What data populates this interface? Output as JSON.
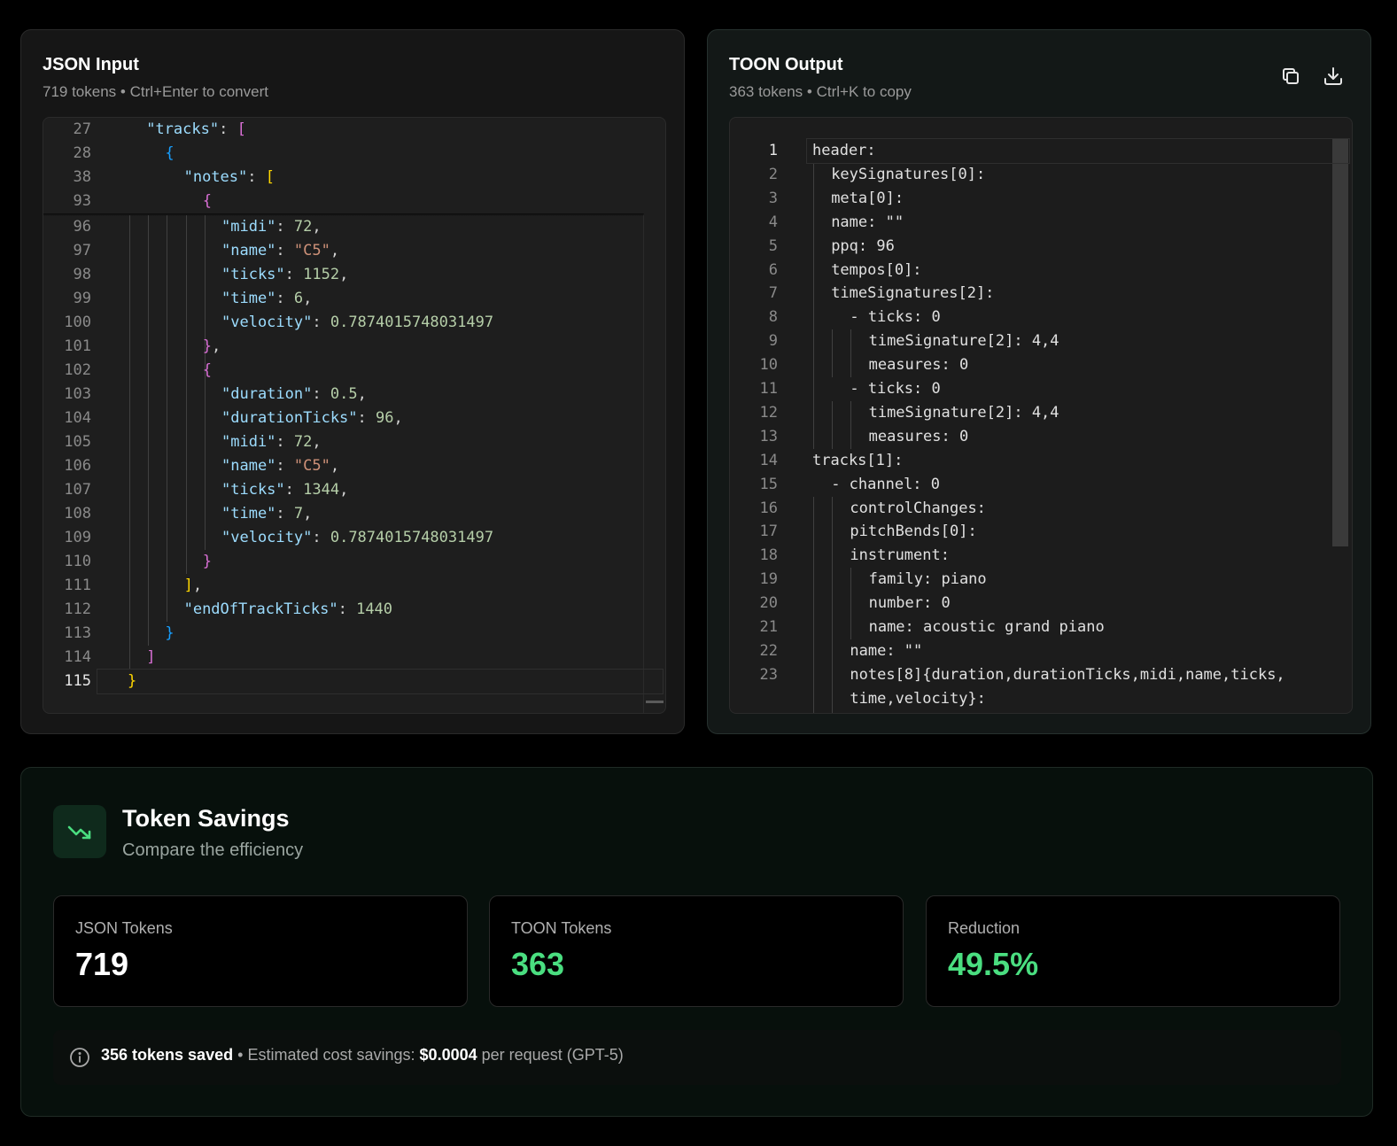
{
  "json_panel": {
    "title": "JSON Input",
    "token_count": "719 tokens",
    "separator": "•",
    "hint": "Ctrl+Enter to convert"
  },
  "toon_panel": {
    "title": "TOON Output",
    "token_count": "363 tokens",
    "separator": "•",
    "hint": "Ctrl+K to copy",
    "copy_icon": "copy-icon",
    "download_icon": "download-icon"
  },
  "json_editor": {
    "sticky": [
      {
        "ln": "27",
        "indent": 1,
        "tokens": [
          {
            "t": "\"tracks\"",
            "c": "k"
          },
          {
            "t": ": ",
            "c": "p"
          },
          {
            "t": "[",
            "c": "b2"
          }
        ]
      },
      {
        "ln": "28",
        "indent": 2,
        "tokens": [
          {
            "t": "{",
            "c": "b3"
          }
        ]
      },
      {
        "ln": "38",
        "indent": 3,
        "tokens": [
          {
            "t": "\"notes\"",
            "c": "k"
          },
          {
            "t": ": ",
            "c": "p"
          },
          {
            "t": "[",
            "c": "b1"
          }
        ]
      },
      {
        "ln": "93",
        "indent": 4,
        "tokens": [
          {
            "t": "{",
            "c": "b2"
          }
        ]
      }
    ],
    "lines": [
      {
        "ln": "96",
        "indent": 5,
        "tokens": [
          {
            "t": "\"midi\"",
            "c": "k"
          },
          {
            "t": ": ",
            "c": "p"
          },
          {
            "t": "72",
            "c": "n"
          },
          {
            "t": ",",
            "c": "p"
          }
        ]
      },
      {
        "ln": "97",
        "indent": 5,
        "tokens": [
          {
            "t": "\"name\"",
            "c": "k"
          },
          {
            "t": ": ",
            "c": "p"
          },
          {
            "t": "\"C5\"",
            "c": "s"
          },
          {
            "t": ",",
            "c": "p"
          }
        ]
      },
      {
        "ln": "98",
        "indent": 5,
        "tokens": [
          {
            "t": "\"ticks\"",
            "c": "k"
          },
          {
            "t": ": ",
            "c": "p"
          },
          {
            "t": "1152",
            "c": "n"
          },
          {
            "t": ",",
            "c": "p"
          }
        ]
      },
      {
        "ln": "99",
        "indent": 5,
        "tokens": [
          {
            "t": "\"time\"",
            "c": "k"
          },
          {
            "t": ": ",
            "c": "p"
          },
          {
            "t": "6",
            "c": "n"
          },
          {
            "t": ",",
            "c": "p"
          }
        ]
      },
      {
        "ln": "100",
        "indent": 5,
        "tokens": [
          {
            "t": "\"velocity\"",
            "c": "k"
          },
          {
            "t": ": ",
            "c": "p"
          },
          {
            "t": "0.7874015748031497",
            "c": "n"
          }
        ]
      },
      {
        "ln": "101",
        "indent": 4,
        "tokens": [
          {
            "t": "}",
            "c": "b2"
          },
          {
            "t": ",",
            "c": "p"
          }
        ]
      },
      {
        "ln": "102",
        "indent": 4,
        "tokens": [
          {
            "t": "{",
            "c": "b2"
          }
        ]
      },
      {
        "ln": "103",
        "indent": 5,
        "tokens": [
          {
            "t": "\"duration\"",
            "c": "k"
          },
          {
            "t": ": ",
            "c": "p"
          },
          {
            "t": "0.5",
            "c": "n"
          },
          {
            "t": ",",
            "c": "p"
          }
        ]
      },
      {
        "ln": "104",
        "indent": 5,
        "tokens": [
          {
            "t": "\"durationTicks\"",
            "c": "k"
          },
          {
            "t": ": ",
            "c": "p"
          },
          {
            "t": "96",
            "c": "n"
          },
          {
            "t": ",",
            "c": "p"
          }
        ]
      },
      {
        "ln": "105",
        "indent": 5,
        "tokens": [
          {
            "t": "\"midi\"",
            "c": "k"
          },
          {
            "t": ": ",
            "c": "p"
          },
          {
            "t": "72",
            "c": "n"
          },
          {
            "t": ",",
            "c": "p"
          }
        ]
      },
      {
        "ln": "106",
        "indent": 5,
        "tokens": [
          {
            "t": "\"name\"",
            "c": "k"
          },
          {
            "t": ": ",
            "c": "p"
          },
          {
            "t": "\"C5\"",
            "c": "s"
          },
          {
            "t": ",",
            "c": "p"
          }
        ]
      },
      {
        "ln": "107",
        "indent": 5,
        "tokens": [
          {
            "t": "\"ticks\"",
            "c": "k"
          },
          {
            "t": ": ",
            "c": "p"
          },
          {
            "t": "1344",
            "c": "n"
          },
          {
            "t": ",",
            "c": "p"
          }
        ]
      },
      {
        "ln": "108",
        "indent": 5,
        "tokens": [
          {
            "t": "\"time\"",
            "c": "k"
          },
          {
            "t": ": ",
            "c": "p"
          },
          {
            "t": "7",
            "c": "n"
          },
          {
            "t": ",",
            "c": "p"
          }
        ]
      },
      {
        "ln": "109",
        "indent": 5,
        "tokens": [
          {
            "t": "\"velocity\"",
            "c": "k"
          },
          {
            "t": ": ",
            "c": "p"
          },
          {
            "t": "0.7874015748031497",
            "c": "n"
          }
        ]
      },
      {
        "ln": "110",
        "indent": 4,
        "tokens": [
          {
            "t": "}",
            "c": "b2"
          }
        ]
      },
      {
        "ln": "111",
        "indent": 3,
        "tokens": [
          {
            "t": "]",
            "c": "b1"
          },
          {
            "t": ",",
            "c": "p"
          }
        ]
      },
      {
        "ln": "112",
        "indent": 3,
        "tokens": [
          {
            "t": "\"endOfTrackTicks\"",
            "c": "k"
          },
          {
            "t": ": ",
            "c": "p"
          },
          {
            "t": "1440",
            "c": "n"
          }
        ]
      },
      {
        "ln": "113",
        "indent": 2,
        "tokens": [
          {
            "t": "}",
            "c": "b3"
          }
        ]
      },
      {
        "ln": "114",
        "indent": 1,
        "tokens": [
          {
            "t": "]",
            "c": "b2"
          }
        ]
      },
      {
        "ln": "115",
        "indent": 0,
        "tokens": [
          {
            "t": "}",
            "c": "b1"
          }
        ],
        "current": true
      }
    ]
  },
  "toon_editor": {
    "lines": [
      {
        "ln": "1",
        "indent": 0,
        "text": "header:",
        "current": true
      },
      {
        "ln": "2",
        "indent": 1,
        "text": "keySignatures[0]:"
      },
      {
        "ln": "3",
        "indent": 1,
        "text": "meta[0]:"
      },
      {
        "ln": "4",
        "indent": 1,
        "text": "name: \"\""
      },
      {
        "ln": "5",
        "indent": 1,
        "text": "ppq: 96"
      },
      {
        "ln": "6",
        "indent": 1,
        "text": "tempos[0]:"
      },
      {
        "ln": "7",
        "indent": 1,
        "text": "timeSignatures[2]:"
      },
      {
        "ln": "8",
        "indent": 2,
        "text": "- ticks: 0"
      },
      {
        "ln": "9",
        "indent": 3,
        "text": "timeSignature[2]: 4,4"
      },
      {
        "ln": "10",
        "indent": 3,
        "text": "measures: 0"
      },
      {
        "ln": "11",
        "indent": 2,
        "text": "- ticks: 0"
      },
      {
        "ln": "12",
        "indent": 3,
        "text": "timeSignature[2]: 4,4"
      },
      {
        "ln": "13",
        "indent": 3,
        "text": "measures: 0"
      },
      {
        "ln": "14",
        "indent": 0,
        "text": "tracks[1]:"
      },
      {
        "ln": "15",
        "indent": 1,
        "text": "- channel: 0"
      },
      {
        "ln": "16",
        "indent": 2,
        "text": "controlChanges:"
      },
      {
        "ln": "17",
        "indent": 2,
        "text": "pitchBends[0]:"
      },
      {
        "ln": "18",
        "indent": 2,
        "text": "instrument:"
      },
      {
        "ln": "19",
        "indent": 3,
        "text": "family: piano"
      },
      {
        "ln": "20",
        "indent": 3,
        "text": "number: 0"
      },
      {
        "ln": "21",
        "indent": 3,
        "text": "name: acoustic grand piano"
      },
      {
        "ln": "22",
        "indent": 2,
        "text": "name: \"\""
      },
      {
        "ln": "23",
        "indent": 2,
        "text": "notes[8]{duration,durationTicks,midi,name,ticks,"
      },
      {
        "ln": "",
        "indent": 2,
        "text": "time,velocity}:"
      }
    ]
  },
  "savings": {
    "icon": "trending-down-icon",
    "title": "Token Savings",
    "subtitle": "Compare the efficiency",
    "cards": [
      {
        "label": "JSON Tokens",
        "value": "719",
        "color": "#ffffff"
      },
      {
        "label": "TOON Tokens",
        "value": "363",
        "color": "#4ade80"
      },
      {
        "label": "Reduction",
        "value": "49.5%",
        "color": "#4ade80"
      }
    ],
    "footer": {
      "info_icon": "info-icon",
      "saved": "356 tokens saved",
      "separator": "•",
      "cost_label": "Estimated cost savings:",
      "cost_value": "$0.0004",
      "cost_suffix": "per request (GPT-5)"
    }
  },
  "colors": {
    "accent_green": "#4ade80",
    "background": "#000000",
    "panel": "#161616"
  }
}
